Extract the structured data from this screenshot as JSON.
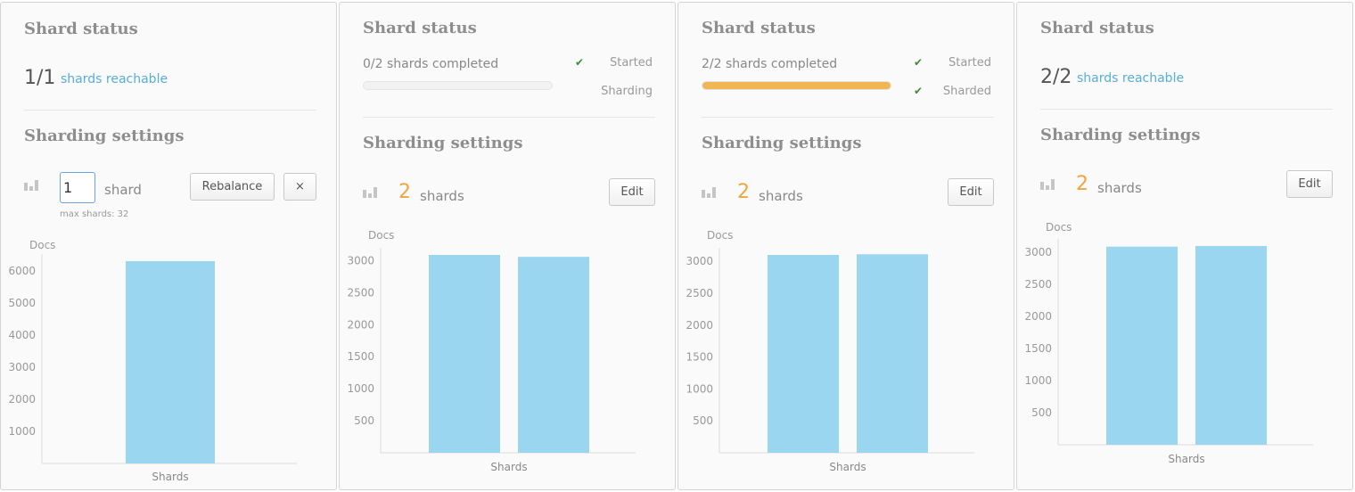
{
  "panels": [
    {
      "id": "p1",
      "status_heading": "Shard status",
      "reachable_count": "1/1",
      "reachable_label": "shards reachable",
      "settings_heading": "Sharding settings",
      "shard_input_value": "1",
      "shard_word": "shard",
      "rebalance_label": "Rebalance",
      "cancel_label": "×",
      "max_shards_text": "max shards: 32"
    },
    {
      "id": "p2",
      "status_heading": "Shard status",
      "completed_text": "0/2 shards completed",
      "progress": 0,
      "steps": [
        {
          "label": "Started",
          "done": true
        },
        {
          "label": "Sharding",
          "done": false
        }
      ],
      "settings_heading": "Sharding settings",
      "shard_count": "2",
      "shard_word": "shards",
      "edit_label": "Edit"
    },
    {
      "id": "p3",
      "status_heading": "Shard status",
      "completed_text": "2/2 shards completed",
      "progress": 1,
      "steps": [
        {
          "label": "Started",
          "done": true
        },
        {
          "label": "Sharded",
          "done": true
        }
      ],
      "settings_heading": "Sharding settings",
      "shard_count": "2",
      "shard_word": "shards",
      "edit_label": "Edit"
    },
    {
      "id": "p4",
      "status_heading": "Shard status",
      "reachable_count": "2/2",
      "reachable_label": "shards reachable",
      "settings_heading": "Sharding settings",
      "shard_count": "2",
      "shard_word": "shards",
      "edit_label": "Edit"
    }
  ],
  "icons": {
    "check": "check-icon",
    "shards_chart": "bar-chart-icon"
  },
  "colors": {
    "bar": "#9ad6f0",
    "link": "#57aed7",
    "accent_orange": "#f0a63e",
    "progress": "#f1b553",
    "check": "#3c8c3c"
  },
  "chart_data": [
    {
      "type": "bar",
      "ylabel": "Docs",
      "xlabel": "Shards",
      "yticks": [
        1000,
        2000,
        3000,
        4000,
        5000,
        6000
      ],
      "ylim": [
        0,
        6300
      ],
      "values": [
        6300
      ]
    },
    {
      "type": "bar",
      "ylabel": "Docs",
      "xlabel": "Shards",
      "yticks": [
        500,
        1000,
        1500,
        2000,
        2500,
        3000
      ],
      "ylim": [
        0,
        3090
      ],
      "values": [
        3090,
        3060
      ]
    },
    {
      "type": "bar",
      "ylabel": "Docs",
      "xlabel": "Shards",
      "yticks": [
        500,
        1000,
        1500,
        2000,
        2500,
        3000
      ],
      "ylim": [
        0,
        3100
      ],
      "values": [
        3100,
        3110
      ]
    },
    {
      "type": "bar",
      "ylabel": "Docs",
      "xlabel": "Shards",
      "yticks": [
        500,
        1000,
        1500,
        2000,
        2500,
        3000
      ],
      "ylim": [
        0,
        3100
      ],
      "values": [
        3090,
        3100
      ]
    }
  ]
}
